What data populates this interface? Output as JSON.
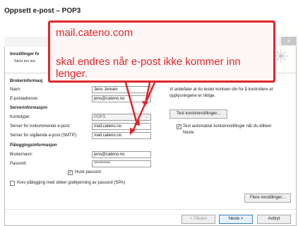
{
  "doc_title": "Oppsett e-post – POP3",
  "window": {
    "close_symbol": "×"
  },
  "header": {
    "title": "Innstillinger fo",
    "subtitle": "Skriv inn inn"
  },
  "left": {
    "user_section": "Brukerinformasj",
    "name_label": "Navn:",
    "name_value": "Jens Jensen",
    "email_label": "E-postadresse:",
    "email_value": "jens@cateno.no",
    "server_section": "Serverinformasjon",
    "type_label": "Kontotype:",
    "type_value": "POP3",
    "incoming_label": "Server for innkommende e-post:",
    "incoming_value": "mail.cateno.no",
    "outgoing_label": "Server for utgående e-post (SMTP):",
    "outgoing_value": "mail.cateno.no",
    "login_section": "Påloggingsinformasjon",
    "username_label": "Brukernavn:",
    "username_value": "jens@cateno.no",
    "password_label": "Passord:",
    "password_value": "**********",
    "remember_label": "Husk passord",
    "spa_label": "Krev pålogging med sikker godkjenning av passord (SPA)"
  },
  "right": {
    "recommend_text": "Vi anbefaler at du tester kontoen din for å kontrollere at opplysningene er riktige.",
    "test_button": "Test kontoinnstillinger...",
    "auto_test_label": "Test automatisk kontoinnstillinger når du klikker Neste",
    "more_button": "Flere innstillinger..."
  },
  "footer": {
    "back": "< Tilbake",
    "next": "Neste >",
    "cancel": "Avbryt"
  },
  "callout": {
    "line1": "mail.cateno.com",
    "line2": "skal endres når e-post ikke kommer inn lenger."
  },
  "colors": {
    "annotation_red": "#e0262b"
  }
}
